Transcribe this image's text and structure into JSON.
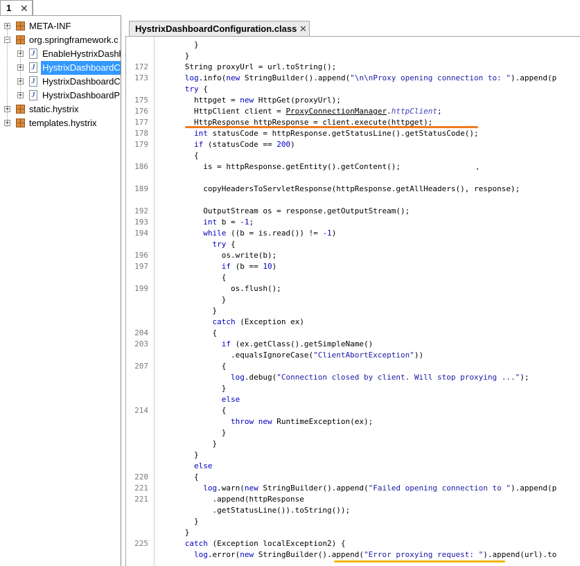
{
  "left_panel": {
    "tab_label": "1",
    "tab_close": "✕",
    "tree": [
      {
        "label": "META-INF",
        "kind": "package",
        "expand": "+"
      },
      {
        "label": "org.springframework.c",
        "kind": "package",
        "expand": "−"
      },
      {
        "label": "EnableHystrixDashb",
        "kind": "class",
        "expand": "+"
      },
      {
        "label": "HystrixDashboardC",
        "kind": "class",
        "expand": "+",
        "selected": true
      },
      {
        "label": "HystrixDashboardC",
        "kind": "class",
        "expand": "+"
      },
      {
        "label": "HystrixDashboardP",
        "kind": "class",
        "expand": "+"
      },
      {
        "label": "static.hystrix",
        "kind": "package",
        "expand": "+"
      },
      {
        "label": "templates.hystrix",
        "kind": "package",
        "expand": "+"
      }
    ]
  },
  "editor": {
    "tab_label": "HystrixDashboardConfiguration.class",
    "tab_close": "✕",
    "line_numbers": [
      "",
      "",
      "172",
      "173",
      "",
      "175",
      "176",
      "177",
      "178",
      "179",
      "",
      "186",
      "",
      "189",
      "",
      "192",
      "193",
      "194",
      "",
      "196",
      "197",
      "",
      "199",
      "",
      "",
      "",
      "204",
      "203",
      "",
      "207",
      "",
      "",
      "",
      "214",
      "",
      "",
      "",
      "",
      "",
      "220",
      "221",
      "221",
      "",
      "",
      "",
      "225",
      ""
    ],
    "code_lines": [
      "        }",
      "      }",
      "      String proxyUrl = url.toString();",
      "      log.info(new StringBuilder().append(\"\\n\\nProxy opening connection to: \").append(p",
      "      try {",
      "        httpget = new HttpGet(proxyUrl);",
      "        HttpClient client = ProxyConnectionManager.httpClient;",
      "        HttpResponse httpResponse = client.execute(httpget);",
      "        int statusCode = httpResponse.getStatusLine().getStatusCode();",
      "        if (statusCode == 200)",
      "        {",
      "          is = httpResponse.getEntity().getContent();",
      "",
      "          copyHeadersToServletResponse(httpResponse.getAllHeaders(), response);",
      "",
      "          OutputStream os = response.getOutputStream();",
      "          int b = -1;",
      "          while ((b = is.read()) != -1)",
      "            try {",
      "              os.write(b);",
      "              if (b == 10)",
      "              {",
      "                os.flush();",
      "              }",
      "            }",
      "            catch (Exception ex)",
      "            {",
      "              if (ex.getClass().getSimpleName()",
      "                .equalsIgnoreCase(\"ClientAbortException\"))",
      "              {",
      "                log.debug(\"Connection closed by client. Will stop proxying ...\");",
      "              }",
      "              else",
      "              {",
      "                throw new RuntimeException(ex);",
      "              }",
      "            }",
      "        }",
      "        else",
      "        {",
      "          log.warn(new StringBuilder().append(\"Failed opening connection to \").append(p",
      "            .append(httpResponse",
      "            .getStatusLine()).toString());",
      "        }",
      "      }",
      "      catch (Exception localException2) {",
      "        log.error(new StringBuilder().append(\"Error proxying request: \").append(url).to"
    ]
  },
  "colors": {
    "selection": "#3399ff",
    "keyword": "#000080",
    "string": "#1a1aa6",
    "underline_orange": "#f27b1b",
    "underline_yellow": "#f0b400"
  }
}
